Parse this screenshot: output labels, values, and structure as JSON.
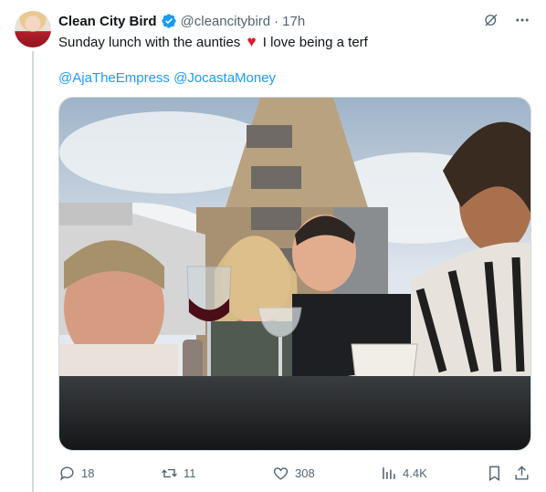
{
  "author": {
    "display_name": "Clean City Bird",
    "handle": "@cleancitybird",
    "separator": "·",
    "time": "17h",
    "verified": true
  },
  "tweet": {
    "text_before": "Sunday lunch with the aunties",
    "emoji": "♥",
    "text_after": "I love being a terf",
    "mentions": [
      "@AjaTheEmpress",
      "@JocastaMoney"
    ]
  },
  "actions": {
    "replies": "18",
    "reposts": "11",
    "likes": "308",
    "views": "4.4K"
  },
  "colors": {
    "accent": "#1d9bf0",
    "muted": "#536471",
    "heart": "#d4232f"
  },
  "icons": [
    "grok-icon",
    "more-icon",
    "reply-icon",
    "repost-icon",
    "like-icon",
    "views-icon",
    "bookmark-icon",
    "share-icon"
  ]
}
